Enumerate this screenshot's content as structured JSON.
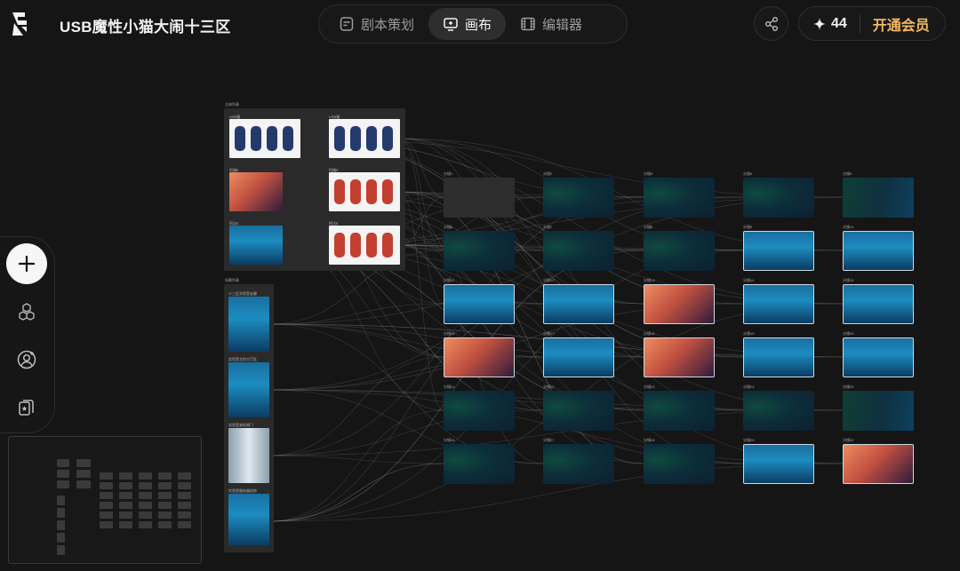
{
  "header": {
    "title": "USB魔性小猫大闹十三区",
    "tabs": [
      {
        "label": "剧本策划",
        "icon": "document-icon",
        "active": false
      },
      {
        "label": "画布",
        "icon": "canvas-icon",
        "active": true
      },
      {
        "label": "编辑器",
        "icon": "film-icon",
        "active": false
      }
    ],
    "credits": "44",
    "vip_label": "开通会员"
  },
  "canvas": {
    "character_group_label": "主体列表",
    "characters": [
      {
        "label": "USB猫",
        "style": "white"
      },
      {
        "label": "USB猫",
        "style": "white"
      },
      {
        "label": "阿福E",
        "style": "warm"
      },
      {
        "label": "阿福E",
        "style": "white"
      },
      {
        "label": "阿达E",
        "style": "blueroom"
      },
      {
        "label": "阿达E",
        "style": "white"
      }
    ],
    "scene_group_label": "场景列表",
    "scenes": [
      {
        "label": "十三区实验室走廊"
      },
      {
        "label": "实验室主控大厅区"
      },
      {
        "label": "实验室安检闸门"
      },
      {
        "label": "实验室服务器机房"
      }
    ],
    "shots": [
      {
        "label": "分镜1",
        "style": "gray"
      },
      {
        "label": "分镜2",
        "style": "teal"
      },
      {
        "label": "分镜3",
        "style": "teal"
      },
      {
        "label": "分镜4",
        "style": "teal"
      },
      {
        "label": "分镜5",
        "style": "teal2"
      },
      {
        "label": "分镜6",
        "style": "teal"
      },
      {
        "label": "分镜7",
        "style": "teal"
      },
      {
        "label": "分镜8",
        "style": "teal"
      },
      {
        "label": "分镜9",
        "style": "blueroom"
      },
      {
        "label": "分镜10",
        "style": "blueroom"
      },
      {
        "label": "分镜11",
        "style": "blueroom"
      },
      {
        "label": "分镜12",
        "style": "blueroom"
      },
      {
        "label": "分镜13",
        "style": "warm"
      },
      {
        "label": "分镜14",
        "style": "blueroom"
      },
      {
        "label": "分镜15",
        "style": "blueroom"
      },
      {
        "label": "分镜16",
        "style": "warm"
      },
      {
        "label": "分镜17",
        "style": "blueroom"
      },
      {
        "label": "分镜18",
        "style": "warm"
      },
      {
        "label": "分镜19",
        "style": "blueroom"
      },
      {
        "label": "分镜20",
        "style": "blueroom"
      },
      {
        "label": "分镜21",
        "style": "teal"
      },
      {
        "label": "分镜22",
        "style": "teal"
      },
      {
        "label": "分镜23",
        "style": "teal"
      },
      {
        "label": "分镜24",
        "style": "teal"
      },
      {
        "label": "分镜25",
        "style": "teal2"
      },
      {
        "label": "分镜26",
        "style": "teal"
      },
      {
        "label": "分镜27",
        "style": "teal"
      },
      {
        "label": "分镜28",
        "style": "teal"
      },
      {
        "label": "分镜29",
        "style": "blueroom"
      },
      {
        "label": "分镜30",
        "style": "warm"
      }
    ]
  },
  "toolbar": {
    "tools": [
      "add-icon",
      "assets-icon",
      "character-icon",
      "cards-icon"
    ]
  }
}
